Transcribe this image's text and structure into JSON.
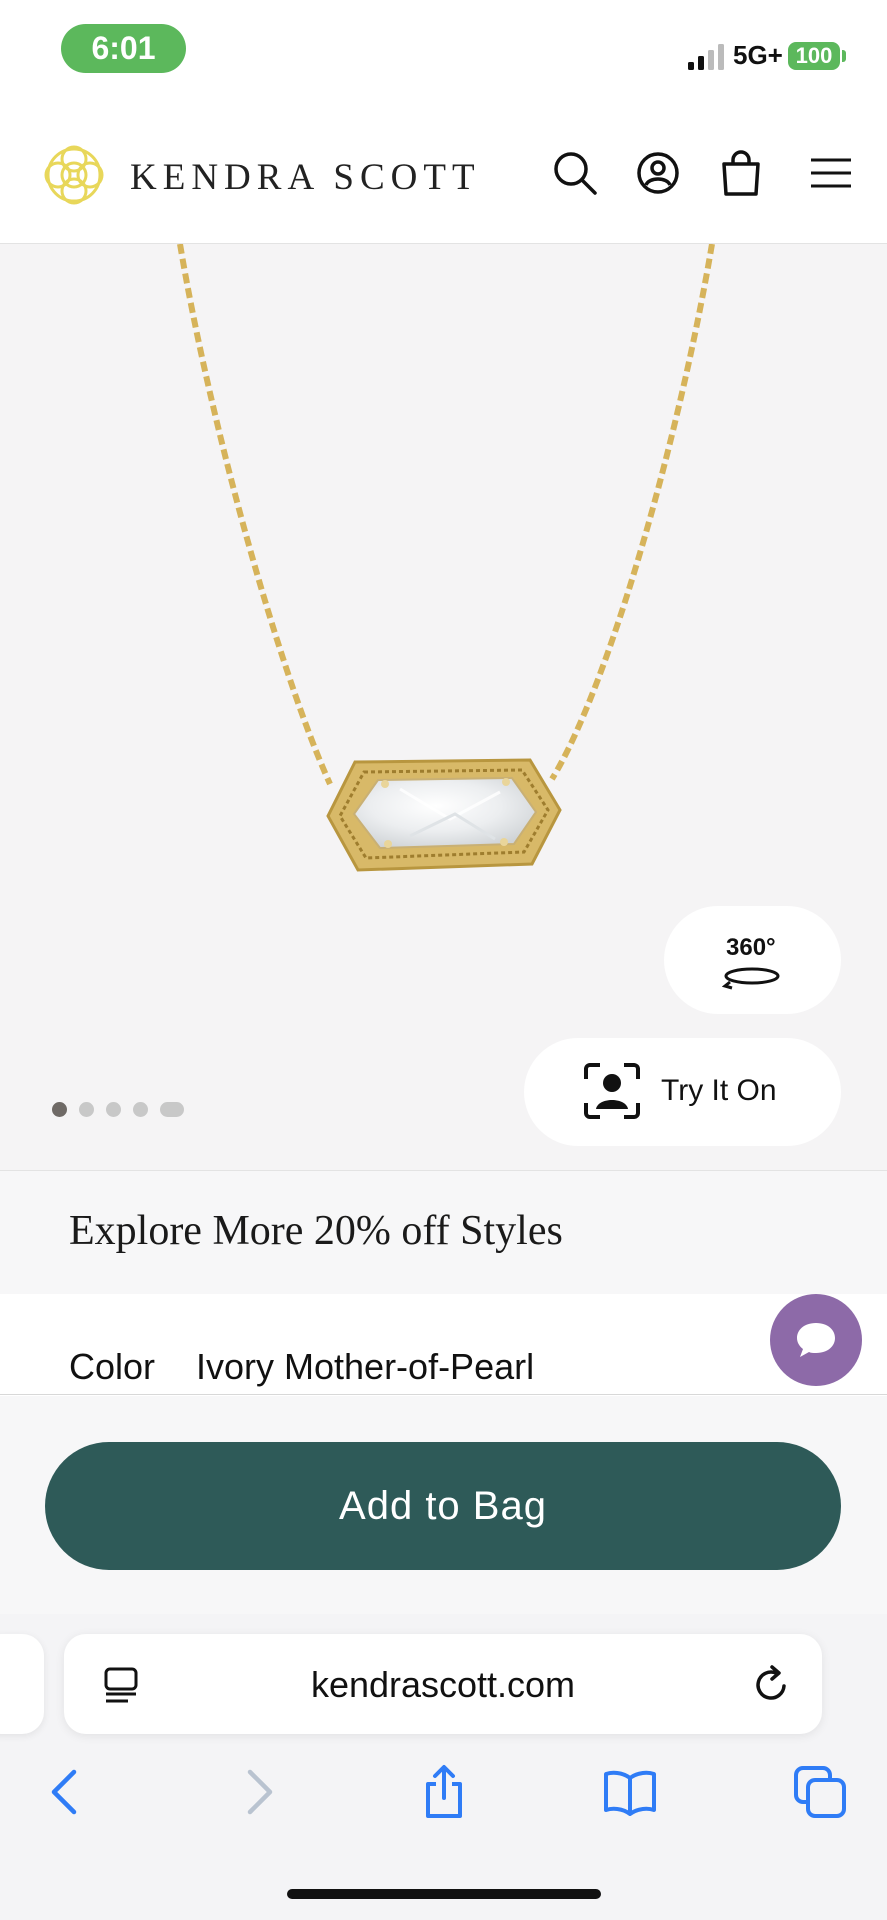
{
  "status_bar": {
    "time": "6:01",
    "network": "5G+",
    "battery": "100"
  },
  "header": {
    "brand": "KENDRA SCOTT"
  },
  "gallery": {
    "btn_360_label": "360°",
    "try_on_label": "Try It On",
    "dot_count": 5,
    "active_dot": 0
  },
  "explore": {
    "text": "Explore More 20% off Styles"
  },
  "color": {
    "label": "Color",
    "value": "Ivory Mother-of-Pearl"
  },
  "cta": {
    "add_to_bag": "Add to Bag"
  },
  "browser": {
    "url": "kendrascott.com"
  },
  "colors": {
    "brand_gold": "#e8d75a",
    "cta_green": "#2e5a58",
    "chat_purple": "#8d6aa8",
    "status_green": "#5cb85c",
    "ios_blue": "#2f7cf6"
  }
}
